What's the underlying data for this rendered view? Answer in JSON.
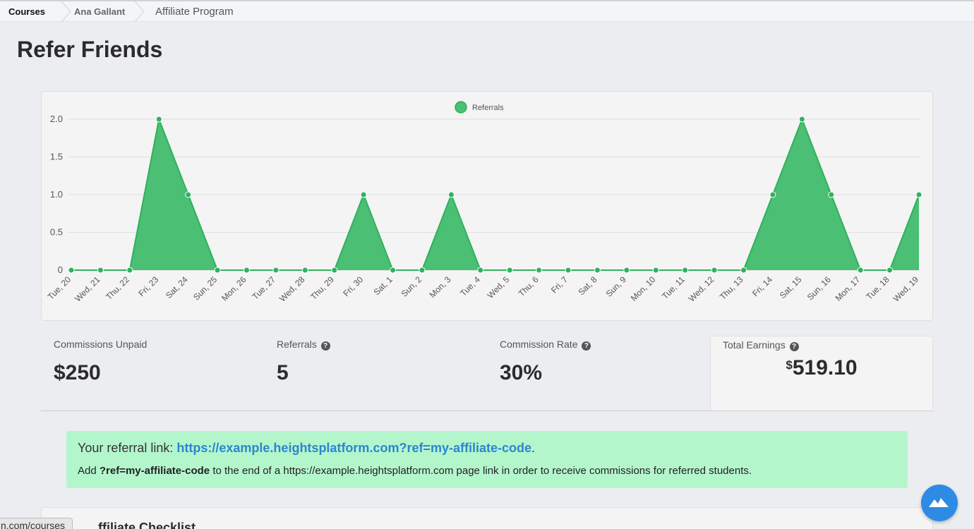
{
  "breadcrumb": {
    "items": [
      "Courses",
      "Ana Gallant",
      "Affiliate Program"
    ]
  },
  "page": {
    "title": "Refer Friends"
  },
  "chart_data": {
    "type": "area",
    "legend": "Referrals",
    "legend_position": "top-center",
    "color": "#4bbf73",
    "line_color": "#2fb15e",
    "ylim": [
      0,
      2
    ],
    "y_ticks": [
      "0",
      "0.5",
      "1.0",
      "1.5",
      "2.0"
    ],
    "grid": true,
    "categories": [
      "Tue, 20",
      "Wed, 21",
      "Thu, 22",
      "Fri, 23",
      "Sat, 24",
      "Sun, 25",
      "Mon, 26",
      "Tue, 27",
      "Wed, 28",
      "Thu, 29",
      "Fri, 30",
      "Sat, 1",
      "Sun, 2",
      "Mon, 3",
      "Tue, 4",
      "Wed, 5",
      "Thu, 6",
      "Fri, 7",
      "Sat, 8",
      "Sun, 9",
      "Mon, 10",
      "Tue, 11",
      "Wed, 12",
      "Thu, 13",
      "Fri, 14",
      "Sat, 15",
      "Sun, 16",
      "Mon, 17",
      "Tue, 18",
      "Wed, 19"
    ],
    "series": [
      {
        "name": "Referrals",
        "values": [
          0,
          0,
          0,
          2,
          1,
          0,
          0,
          0,
          0,
          0,
          1,
          0,
          0,
          1,
          0,
          0,
          0,
          0,
          0,
          0,
          0,
          0,
          0,
          0,
          1,
          2,
          1,
          0,
          0,
          1
        ]
      }
    ]
  },
  "stats": {
    "commissions_unpaid": {
      "label": "Commissions Unpaid",
      "value": "$250"
    },
    "referrals": {
      "label": "Referrals",
      "value": "5"
    },
    "commission_rate": {
      "label": "Commission Rate",
      "value": "30%"
    },
    "total_earnings": {
      "label": "Total Earnings",
      "currency": "$",
      "value": "519.10"
    }
  },
  "referral": {
    "prefix": "Your referral link: ",
    "link": "https://example.heightsplatform.com?ref=my-affiliate-code",
    "suffix": ".",
    "help_prefix": "Add ",
    "help_code": "?ref=my-affiliate-code",
    "help_suffix": " to the end of a https://example.heightsplatform.com page link in order to receive commissions for referred students."
  },
  "bottom": {
    "heading_partial": "ffiliate Checklist"
  },
  "status_url": "n.com/courses",
  "help_char": "?"
}
